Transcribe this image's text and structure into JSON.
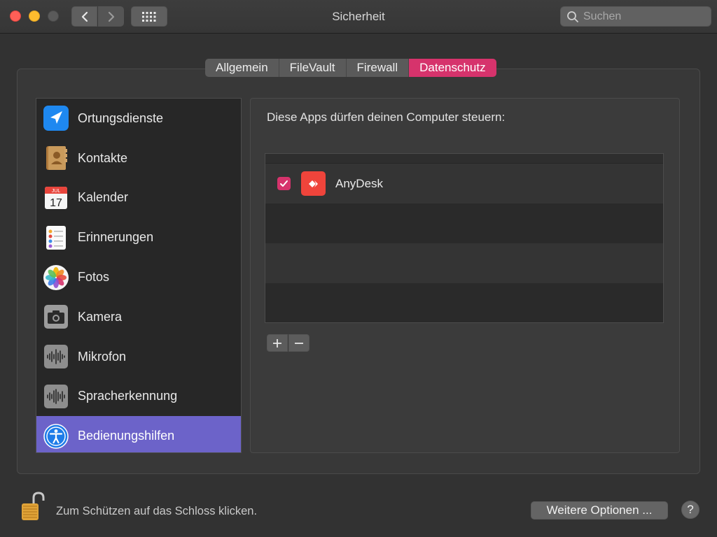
{
  "window": {
    "title": "Sicherheit",
    "search_placeholder": "Suchen"
  },
  "tabs": [
    {
      "label": "Allgemein",
      "active": false
    },
    {
      "label": "FileVault",
      "active": false
    },
    {
      "label": "Firewall",
      "active": false
    },
    {
      "label": "Datenschutz",
      "active": true
    }
  ],
  "sidebar": {
    "items": [
      {
        "label": "Ortungsdienste",
        "icon": "location-arrow-icon"
      },
      {
        "label": "Kontakte",
        "icon": "contacts-book-icon"
      },
      {
        "label": "Kalender",
        "icon": "calendar-icon",
        "month": "JUL",
        "day": "17"
      },
      {
        "label": "Erinnerungen",
        "icon": "reminders-list-icon"
      },
      {
        "label": "Fotos",
        "icon": "photos-flower-icon"
      },
      {
        "label": "Kamera",
        "icon": "camera-icon"
      },
      {
        "label": "Mikrofon",
        "icon": "microphone-waveform-icon"
      },
      {
        "label": "Spracherkennung",
        "icon": "speech-waveform-icon"
      },
      {
        "label": "Bedienungshilfen",
        "icon": "accessibility-icon",
        "selected": true
      }
    ]
  },
  "panel": {
    "heading": "Diese Apps dürfen deinen Computer steuern:",
    "apps": [
      {
        "name": "AnyDesk",
        "checked": true,
        "icon": "anydesk-icon"
      }
    ]
  },
  "footer": {
    "lock_text": "Zum Schützen auf das Schloss klicken.",
    "more_options_label": "Weitere Optionen ...",
    "help_label": "?"
  },
  "colors": {
    "accent": "#d6336c",
    "selection": "#6c63c9",
    "anydesk": "#ef443b"
  }
}
